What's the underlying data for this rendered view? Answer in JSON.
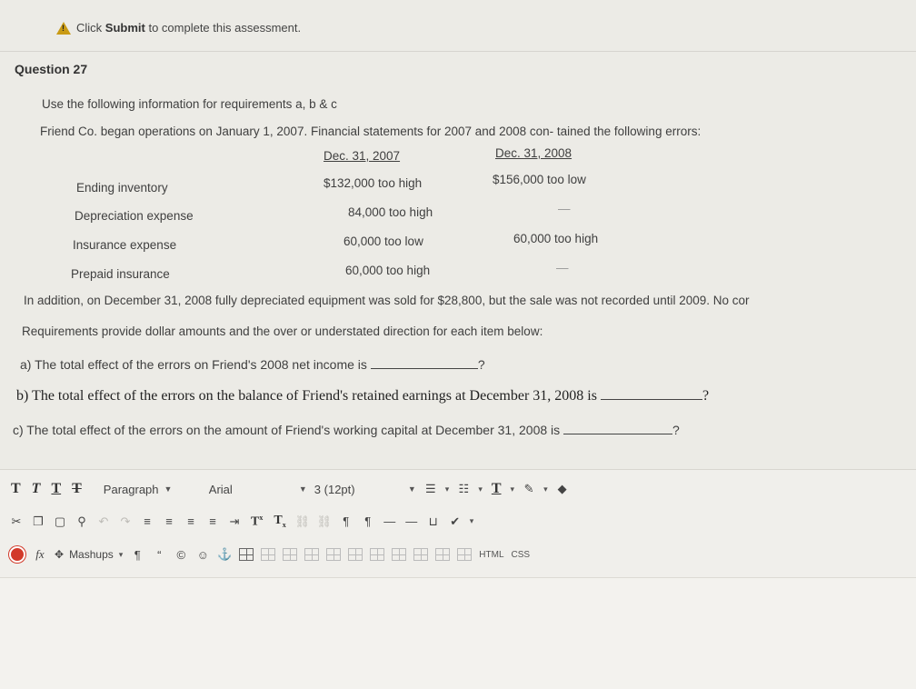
{
  "notice": {
    "icon": "warning-icon",
    "prefix": "Click ",
    "bold": "Submit",
    "suffix": " to complete this assessment."
  },
  "question": {
    "title": "Question 27",
    "intro": "Use the following information for requirements a, b & c",
    "context": "Friend Co. began operations on January 1, 2007. Financial statements for 2007 and 2008 con- tained the following errors:",
    "col_headers": [
      "Dec. 31, 2007",
      "Dec. 31, 2008"
    ],
    "rows": [
      {
        "label": "Ending inventory",
        "y2007": "$132,000 too high",
        "y2008": "$156,000 too low"
      },
      {
        "label": "Depreciation expense",
        "y2007": "84,000 too high",
        "y2008": "—"
      },
      {
        "label": "Insurance expense",
        "y2007": "60,000 too low",
        "y2008": "60,000 too high"
      },
      {
        "label": "Prepaid insurance",
        "y2007": "60,000 too high",
        "y2008": "—"
      }
    ],
    "addition": "In addition, on December 31, 2008 fully depreciated equipment was sold for $28,800, but the sale was not recorded until 2009. No cor",
    "requirements": "Requirements provide dollar amounts and the over or understated direction for each item below:",
    "a": "a) The total effect of the errors on Friend's 2008 net income is",
    "b": "b) The total effect of the errors on the balance of Friend's retained earnings at December 31, 2008 is",
    "c": "c) The total effect of the errors on the amount of Friend's working capital at December 31, 2008 is",
    "qmark": "?"
  },
  "toolbar": {
    "row1": {
      "style_buttons": [
        "T",
        "T",
        "T",
        "T"
      ],
      "format": "Paragraph",
      "font": "Arial",
      "size": "3 (12pt)"
    },
    "row3": {
      "mashups": "Mashups",
      "html": "HTML",
      "css": "CSS"
    }
  }
}
